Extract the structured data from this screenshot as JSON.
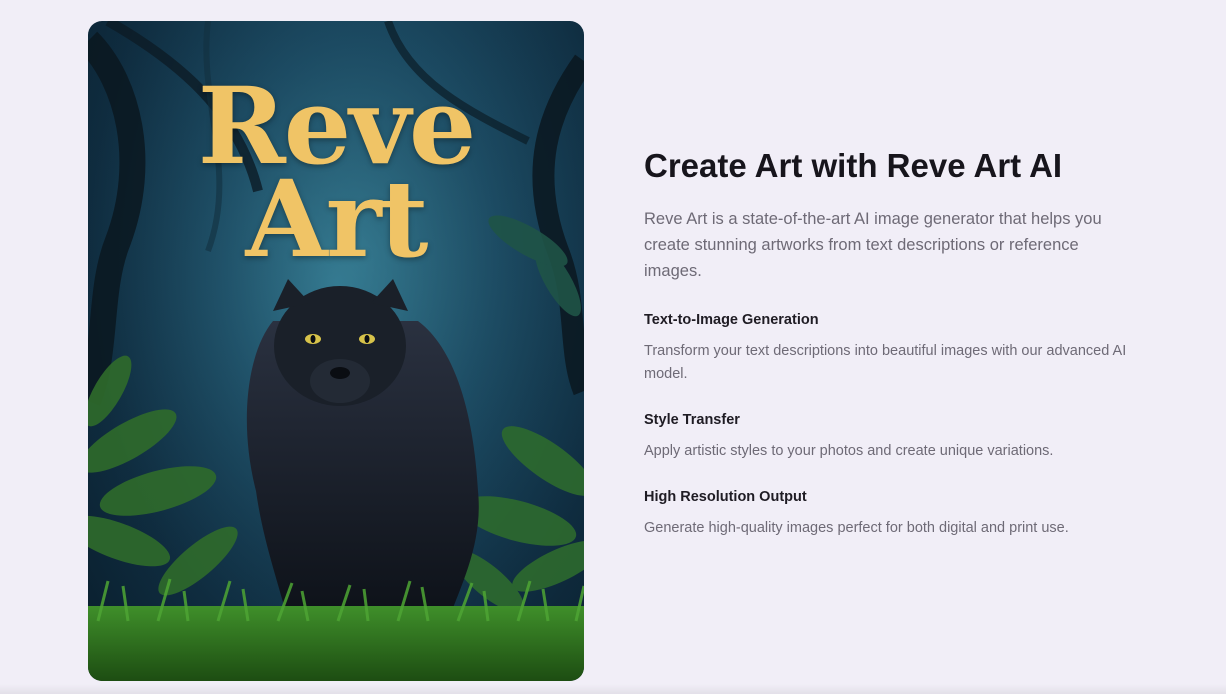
{
  "art": {
    "title_line1": "Reve",
    "title_line2": "Art"
  },
  "section": {
    "headline": "Create Art with Reve Art AI",
    "intro": "Reve Art is a state-of-the-art AI image generator that helps you create stunning artworks from text descriptions or reference images."
  },
  "features": [
    {
      "title": "Text-to-Image Generation",
      "description": "Transform your text descriptions into beautiful images with our advanced AI model."
    },
    {
      "title": "Style Transfer",
      "description": "Apply artistic styles to your photos and create unique variations."
    },
    {
      "title": "High Resolution Output",
      "description": "Generate high-quality images perfect for both digital and print use."
    }
  ],
  "colors": {
    "background": "#f1eef7",
    "accent_gold": "#f0c466",
    "heading": "#17151c",
    "body_text": "#6e6a76"
  }
}
